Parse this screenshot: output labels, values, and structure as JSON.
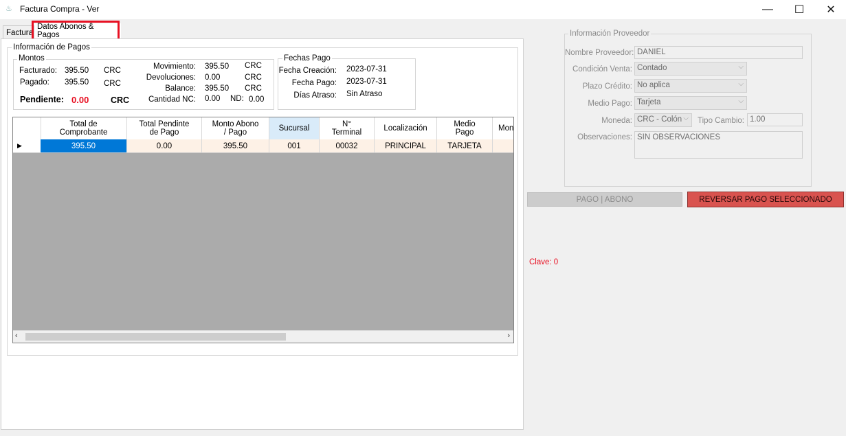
{
  "window": {
    "title": "Factura Compra - Ver",
    "controls": {
      "minimize": "—",
      "maximize": "☐",
      "close": "✕"
    }
  },
  "tabs": [
    {
      "label": "Factura"
    },
    {
      "label": "Datos Abonos & Pagos"
    }
  ],
  "pagos": {
    "group_label": "Información de Pagos",
    "montos": {
      "label": "Montos",
      "facturado_label": "Facturado:",
      "facturado": "395.50",
      "facturado_currency": "CRC",
      "pagado_label": "Pagado:",
      "pagado": "395.50",
      "pagado_currency": "CRC",
      "pendiente_label": "Pendiente:",
      "pendiente": "0.00",
      "pendiente_currency": "CRC",
      "movimiento_label": "Movimiento:",
      "movimiento": "395.50",
      "movimiento_currency": "CRC",
      "devoluciones_label": "Devoluciones:",
      "devoluciones": "0.00",
      "devoluciones_currency": "CRC",
      "balance_label": "Balance:",
      "balance": "395.50",
      "balance_currency": "CRC",
      "cantidad_nc_label": "Cantidad NC:",
      "cantidad_nc": "0.00",
      "nd_label": "ND:",
      "nd": "0.00"
    },
    "fechas": {
      "label": "Fechas Pago",
      "creacion_label": "Fecha Creación:",
      "creacion": "2023-07-31",
      "pago_label": "Fecha Pago:",
      "pago": "2023-07-31",
      "atraso_label": "Días Atraso:",
      "atraso": "Sin Atraso"
    }
  },
  "grid": {
    "columns": [
      "Total de\nComprobante",
      "Total Pendinte\nde Pago",
      "Monto Abono\n/ Pago",
      "Sucursal",
      "N°\nTerminal",
      "Localización",
      "Medio\nPago",
      "Mon"
    ],
    "rows": [
      [
        "395.50",
        "0.00",
        "395.50",
        "001",
        "00032",
        "PRINCIPAL",
        "TARJETA",
        "("
      ]
    ]
  },
  "proveedor": {
    "group_label": "Información Proveedor",
    "nombre_label": "Nombre Proveedor:",
    "nombre": "DANIEL",
    "condicion_label": "Condición Venta:",
    "condicion": "Contado",
    "plazo_label": "Plazo Crédito:",
    "plazo": "No aplica",
    "medio_label": "Medio Pago:",
    "medio": "Tarjeta",
    "moneda_label": "Moneda:",
    "moneda": "CRC - Colón",
    "tipo_cambio_label": "Tipo Cambio:",
    "tipo_cambio": "1.00",
    "observaciones_label": "Observaciones:",
    "observaciones": "SIN OBSERVACIONES"
  },
  "actions": {
    "pago_abono": "PAGO | ABONO",
    "reversar": "REVERSAR PAGO SELECCIONADO"
  },
  "clave": "Clave: 0",
  "colors": {
    "selected_cell": "#0078d7",
    "highlight_border": "#e81123",
    "reversar_bg": "#d9534f",
    "pendiente": "#e81123"
  }
}
